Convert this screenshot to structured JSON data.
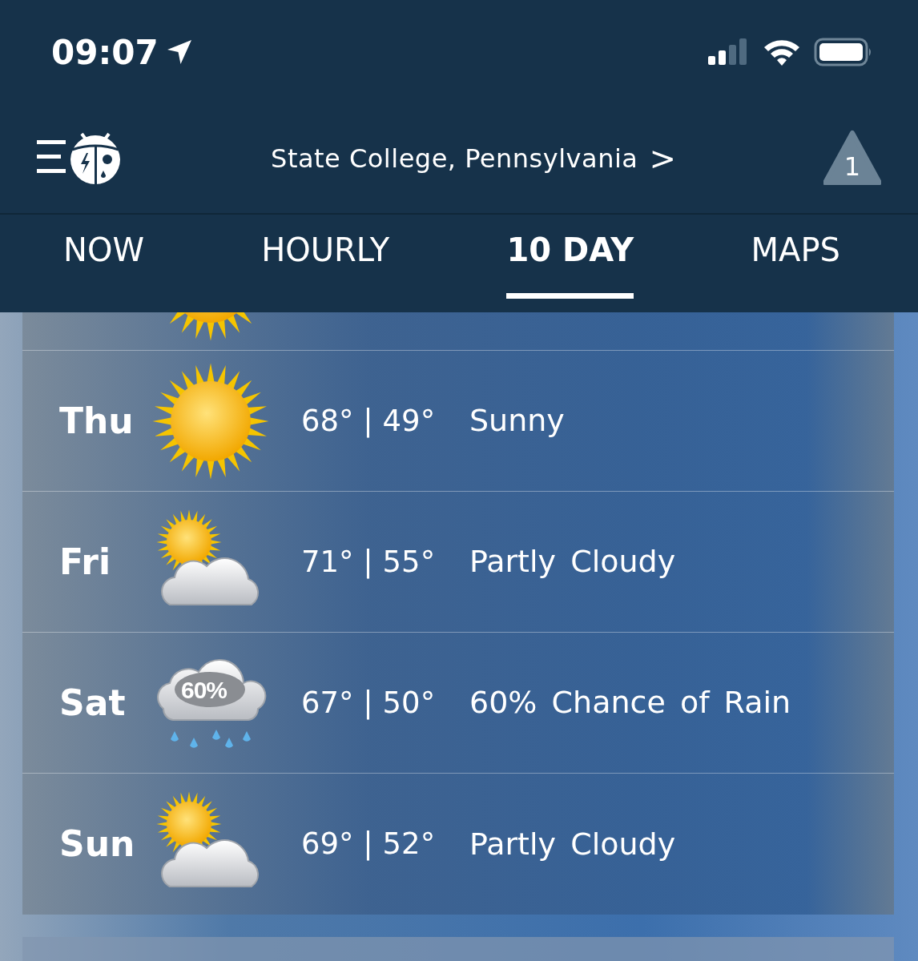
{
  "status_bar": {
    "time": "09:07"
  },
  "header": {
    "location": "State College, Pennsylvania",
    "chevron": ">",
    "alert_count": "1"
  },
  "tabs": [
    {
      "label": "NOW",
      "selected": false
    },
    {
      "label": "HOURLY",
      "selected": false
    },
    {
      "label": "10 DAY",
      "selected": true
    },
    {
      "label": "MAPS",
      "selected": false
    }
  ],
  "partial_row": {
    "kind": "sunny"
  },
  "days": [
    {
      "day": "Thu",
      "kind": "sunny",
      "temps": "68° | 49°",
      "condition": "Sunny"
    },
    {
      "day": "Fri",
      "kind": "partly_cloudy",
      "temps": "71° | 55°",
      "condition": "Partly Cloudy"
    },
    {
      "day": "Sat",
      "kind": "rain",
      "icon_label": "60%",
      "temps": "67° | 50°",
      "condition": "60% Chance of Rain"
    },
    {
      "day": "Sun",
      "kind": "partly_cloudy",
      "temps": "69° | 52°",
      "condition": "Partly Cloudy"
    }
  ]
}
